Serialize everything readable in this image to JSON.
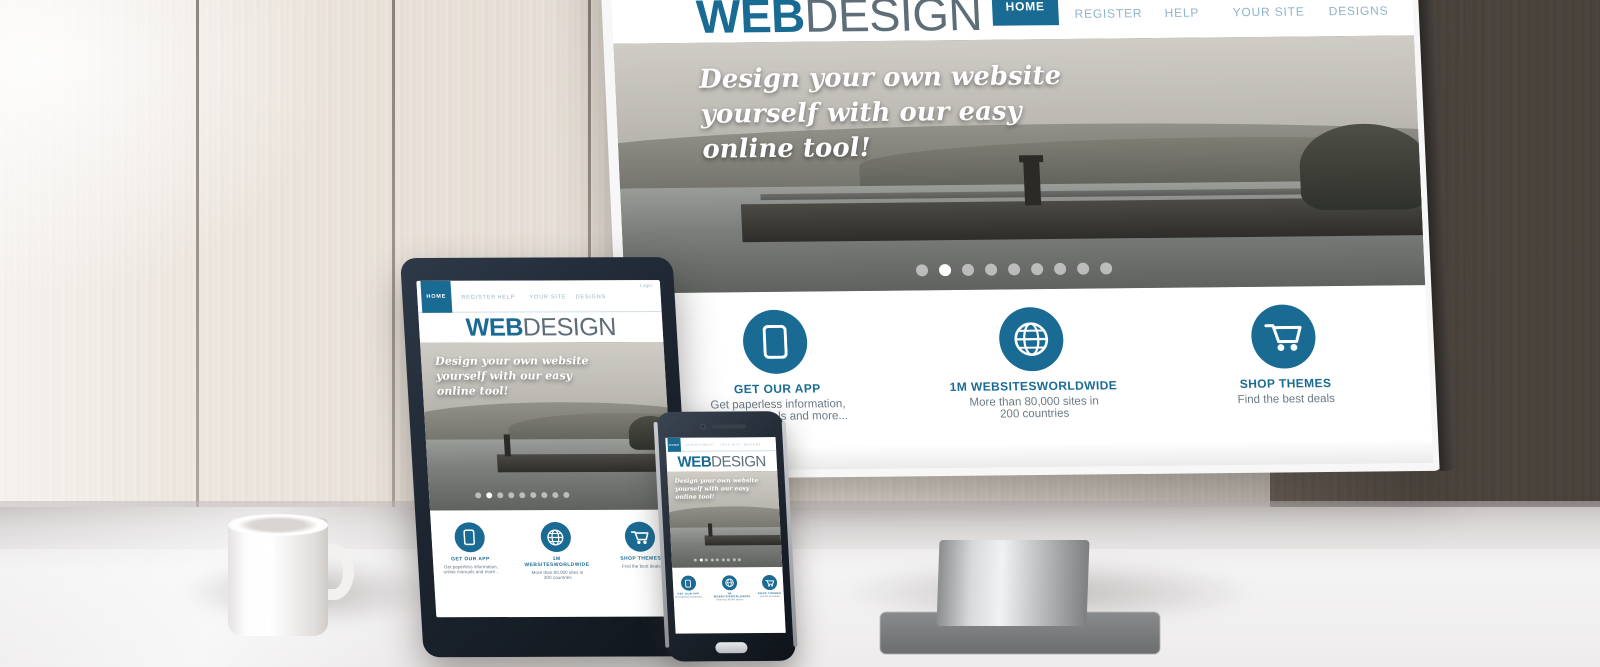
{
  "scene": {
    "description": "Responsive web design mockup on monitor, tablet and smartphone on a white glossy desk against a whitewashed wood wall",
    "objects": [
      "wood-wall",
      "white-desk",
      "coffee-mug",
      "desktop-monitor",
      "tablet",
      "smartphone"
    ]
  },
  "colors": {
    "brand_blue": "#1a6b94",
    "nav_link": "#8fb4c8",
    "logo_dark": "#5d6e78",
    "feature_text": "#6a7a84",
    "device_bezel": "#1d2530",
    "wall_light": "#e8e0d8",
    "desk_white": "#f4f3f3"
  },
  "site": {
    "logo": {
      "bold": "WEB",
      "light": "DESIGN"
    },
    "login_label": "Login",
    "nav": [
      {
        "label": "HOME",
        "active": true
      },
      {
        "label": "REGISTER",
        "active": false
      },
      {
        "label": "HELP",
        "active": false
      },
      {
        "label": "YOUR SITE",
        "active": false
      },
      {
        "label": "DESIGNS",
        "active": false
      }
    ],
    "hero": {
      "line1": "Design your own website",
      "line2": "yourself with our easy",
      "line3": "online tool!",
      "slider": {
        "total": 9,
        "active_index": 1
      }
    },
    "features": [
      {
        "icon": "mobile-phone-icon",
        "title": "GET OUR APP",
        "desc_line1": "Get paperless information,",
        "desc_line2": "online manuals and more..."
      },
      {
        "icon": "globe-icon",
        "title": "1M WEBSITESWORLDWIDE",
        "desc_line1": "More than 80,000 sites in",
        "desc_line2": "200 countries"
      },
      {
        "icon": "shopping-cart-icon",
        "title": "SHOP THEMES",
        "desc_line1": "Find the best deals",
        "desc_line2": ""
      }
    ]
  },
  "devices": {
    "monitor": {
      "name": "Desktop monitor"
    },
    "tablet": {
      "name": "Tablet"
    },
    "phone": {
      "name": "Smartphone"
    }
  }
}
